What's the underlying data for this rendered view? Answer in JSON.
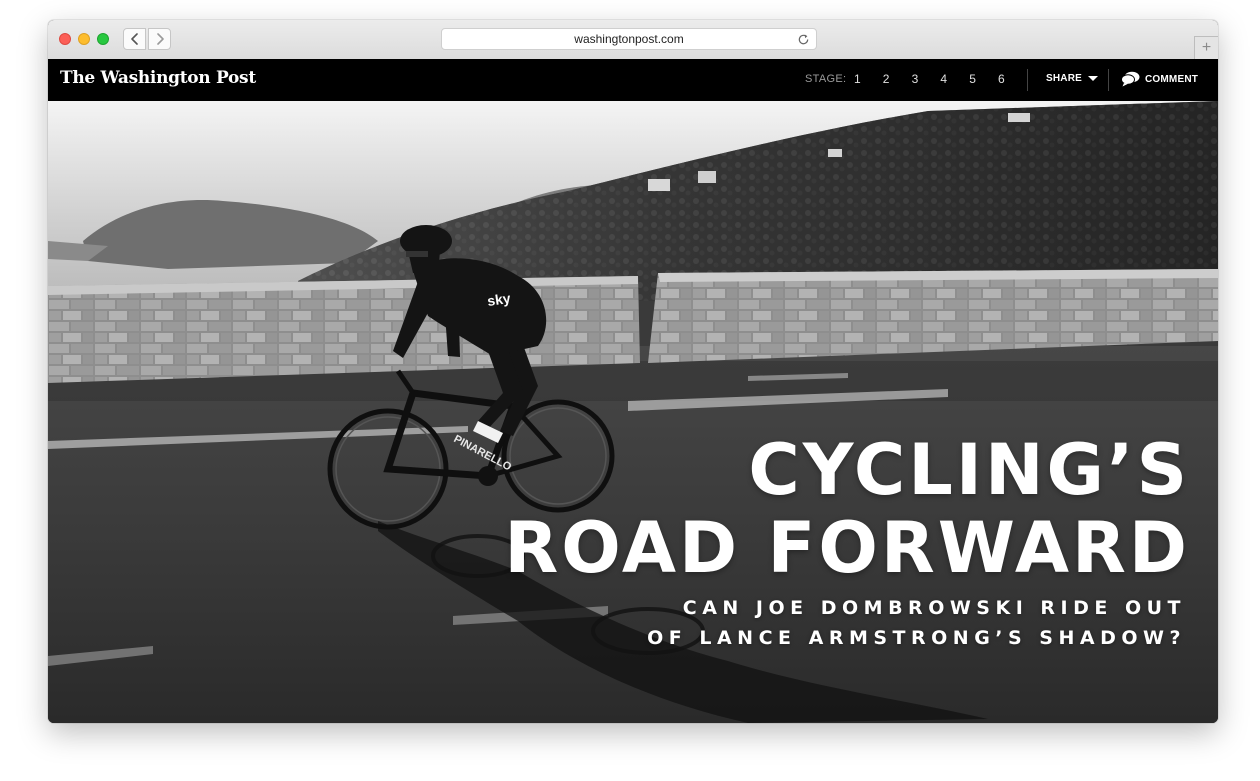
{
  "browser": {
    "url": "washingtonpost.com",
    "icons": {
      "back": "chevron-left-icon",
      "forward": "chevron-right-icon",
      "reload": "reload-icon",
      "new_tab": "plus-icon"
    },
    "new_tab_glyph": "+"
  },
  "site": {
    "logo": "The Washington Post",
    "stage_label": "STAGE:",
    "stages": [
      "1",
      "2",
      "3",
      "4",
      "5",
      "6"
    ],
    "share_label": "SHARE",
    "comment_label": "COMMENT",
    "comment_icon": "speech-bubble-icon"
  },
  "hero": {
    "headline_line1": "CYCLING’S",
    "headline_line2": "ROAD FORWARD",
    "subhead_line1": "CAN JOE DOMBROWSKI RIDE OUT",
    "subhead_line2": "OF LANCE ARMSTRONG’S SHADOW?",
    "jersey_text": "sky",
    "bike_text": "PINARELLO"
  },
  "colors": {
    "header_bg": "#000000",
    "traffic_red": "#fc5f57",
    "traffic_yellow": "#fdbd2e",
    "traffic_green": "#28c840"
  }
}
